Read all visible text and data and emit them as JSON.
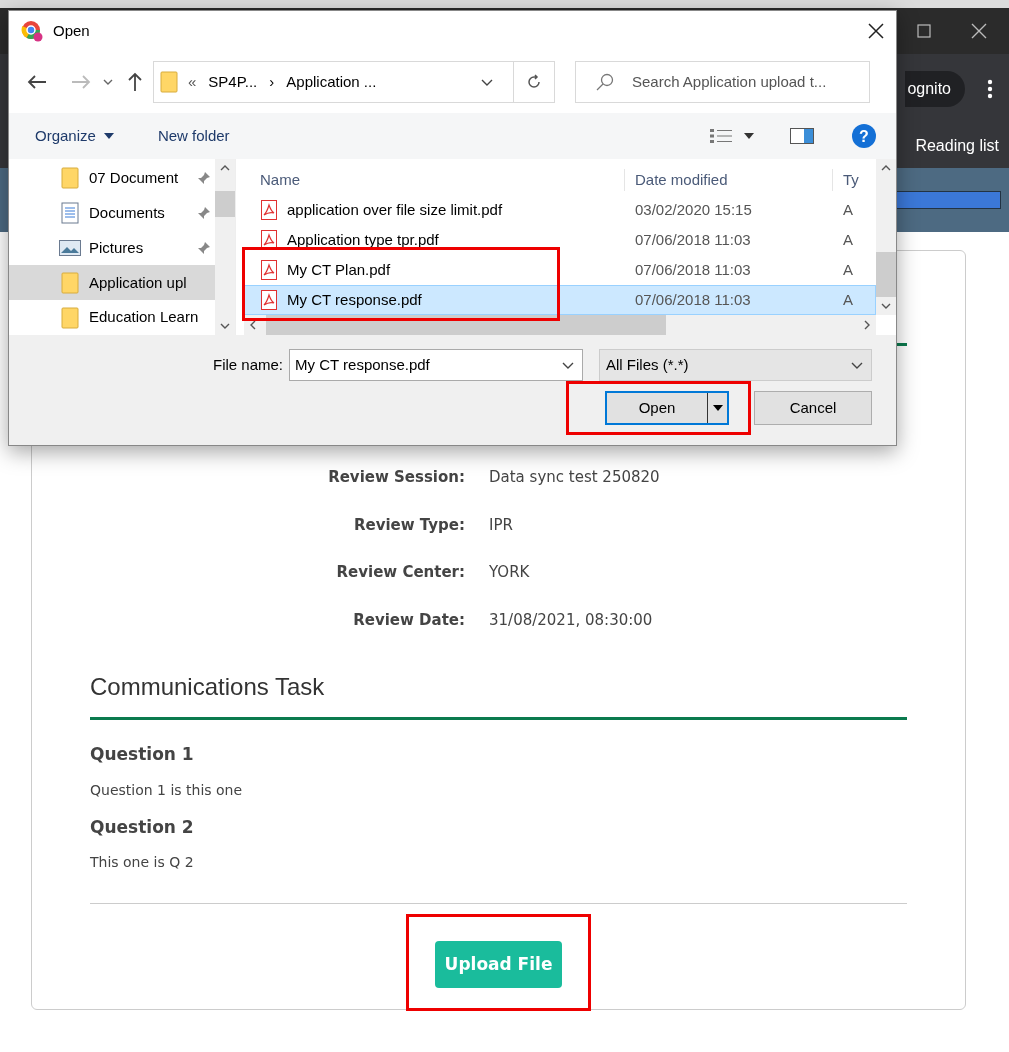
{
  "browser": {
    "profile_chip": "ognito",
    "reading_list": "Reading list"
  },
  "dialog": {
    "title": "Open",
    "address": {
      "prefix": "«",
      "separator": "›",
      "crumbs": [
        "SP4P...",
        "Application ..."
      ]
    },
    "help": "?",
    "search": {
      "placeholder": "Search Application upload t..."
    },
    "toolbar": [
      "Organize",
      "New folder"
    ],
    "nav_items": [
      {
        "label": "07 Document",
        "kind": "folder",
        "pinned": true,
        "selected": false
      },
      {
        "label": "Documents",
        "kind": "document",
        "pinned": true,
        "selected": false
      },
      {
        "label": "Pictures",
        "kind": "picture",
        "pinned": true,
        "selected": false
      },
      {
        "label": "Application upl",
        "kind": "folder",
        "pinned": false,
        "selected": true
      },
      {
        "label": "Education Learn",
        "kind": "folder",
        "pinned": false,
        "selected": false
      }
    ],
    "columns": [
      "Name",
      "Date modified",
      "Ty"
    ],
    "files": [
      {
        "name": "application over file size limit.pdf",
        "date": "03/02/2020 15:15",
        "column_3": "A",
        "selected": false,
        "highlighted": false
      },
      {
        "name": "Application type tpr.pdf",
        "date": "07/06/2018 11:03",
        "column_3": "A",
        "selected": false,
        "highlighted": false
      },
      {
        "name": "My CT Plan.pdf",
        "date": "07/06/2018 11:03",
        "column_3": "A",
        "selected": false,
        "highlighted": true
      },
      {
        "name": "My CT response.pdf",
        "date": "07/06/2018 11:03",
        "column_3": "A",
        "selected": true,
        "highlighted": true
      }
    ],
    "file_name": {
      "label": "File name:",
      "value": "My CT response.pdf"
    },
    "file_type": "All Files (*.*)",
    "buttons": [
      {
        "label": "Open",
        "kind": "split",
        "highlighted": true
      },
      {
        "label": "Cancel",
        "kind": "plain",
        "highlighted": false
      }
    ]
  },
  "page": {
    "details": [
      {
        "label": "Review Session:",
        "value": "Data sync test 250820"
      },
      {
        "label": "Review Type:",
        "value": "IPR"
      },
      {
        "label": "Review Center:",
        "value": "YORK"
      },
      {
        "label": "Review Date:",
        "value": "31/08/2021, 08:30:00"
      }
    ],
    "section_title": "Communications Task",
    "questions": [
      {
        "title": "Question 1",
        "text": "Question 1 is this one"
      },
      {
        "title": "Question 2",
        "text": "This one is Q 2"
      }
    ],
    "upload_button": {
      "label": "Upload File",
      "highlighted": true
    }
  }
}
